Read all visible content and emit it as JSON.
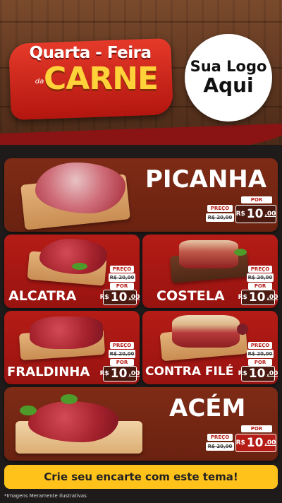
{
  "header": {
    "banner_line1": "Quarta - Feira",
    "banner_da": "da",
    "banner_main": "CARNE",
    "logo_line1": "Sua Logo",
    "logo_line2": "Aqui"
  },
  "products": [
    {
      "name": "PICANHA",
      "preco_label": "PREÇO",
      "old_price": "R$ 20,00",
      "por_label": "POR",
      "currency": "R$",
      "price_int": "10",
      "price_dec": ",00"
    },
    {
      "name": "ALCATRA",
      "preco_label": "PREÇO",
      "old_price": "R$ 20,00",
      "por_label": "POR",
      "currency": "R$",
      "price_int": "10",
      "price_dec": ",00"
    },
    {
      "name": "COSTELA",
      "preco_label": "PREÇO",
      "old_price": "R$ 20,00",
      "por_label": "POR",
      "currency": "R$",
      "price_int": "10",
      "price_dec": ",00"
    },
    {
      "name": "FRALDINHA",
      "preco_label": "PREÇO",
      "old_price": "R$ 20,00",
      "por_label": "POR",
      "currency": "R$",
      "price_int": "10",
      "price_dec": ",00"
    },
    {
      "name": "CONTRA FILÉ",
      "preco_label": "PREÇO",
      "old_price": "R$ 20,00",
      "por_label": "POR",
      "currency": "R$",
      "price_int": "10",
      "price_dec": ",00"
    },
    {
      "name": "ACÉM",
      "preco_label": "PREÇO",
      "old_price": "R$ 20,00",
      "por_label": "POR",
      "currency": "R$",
      "price_int": "10",
      "price_dec": ",00"
    }
  ],
  "cta": {
    "label": "Crie seu encarte com este tema!"
  },
  "disclaimer": "*Imagens Meramente Ilustrativas",
  "colors": {
    "accent_red": "#b51c16",
    "cta_yellow": "#ffc21a",
    "banner_yellow": "#ffd23a"
  }
}
